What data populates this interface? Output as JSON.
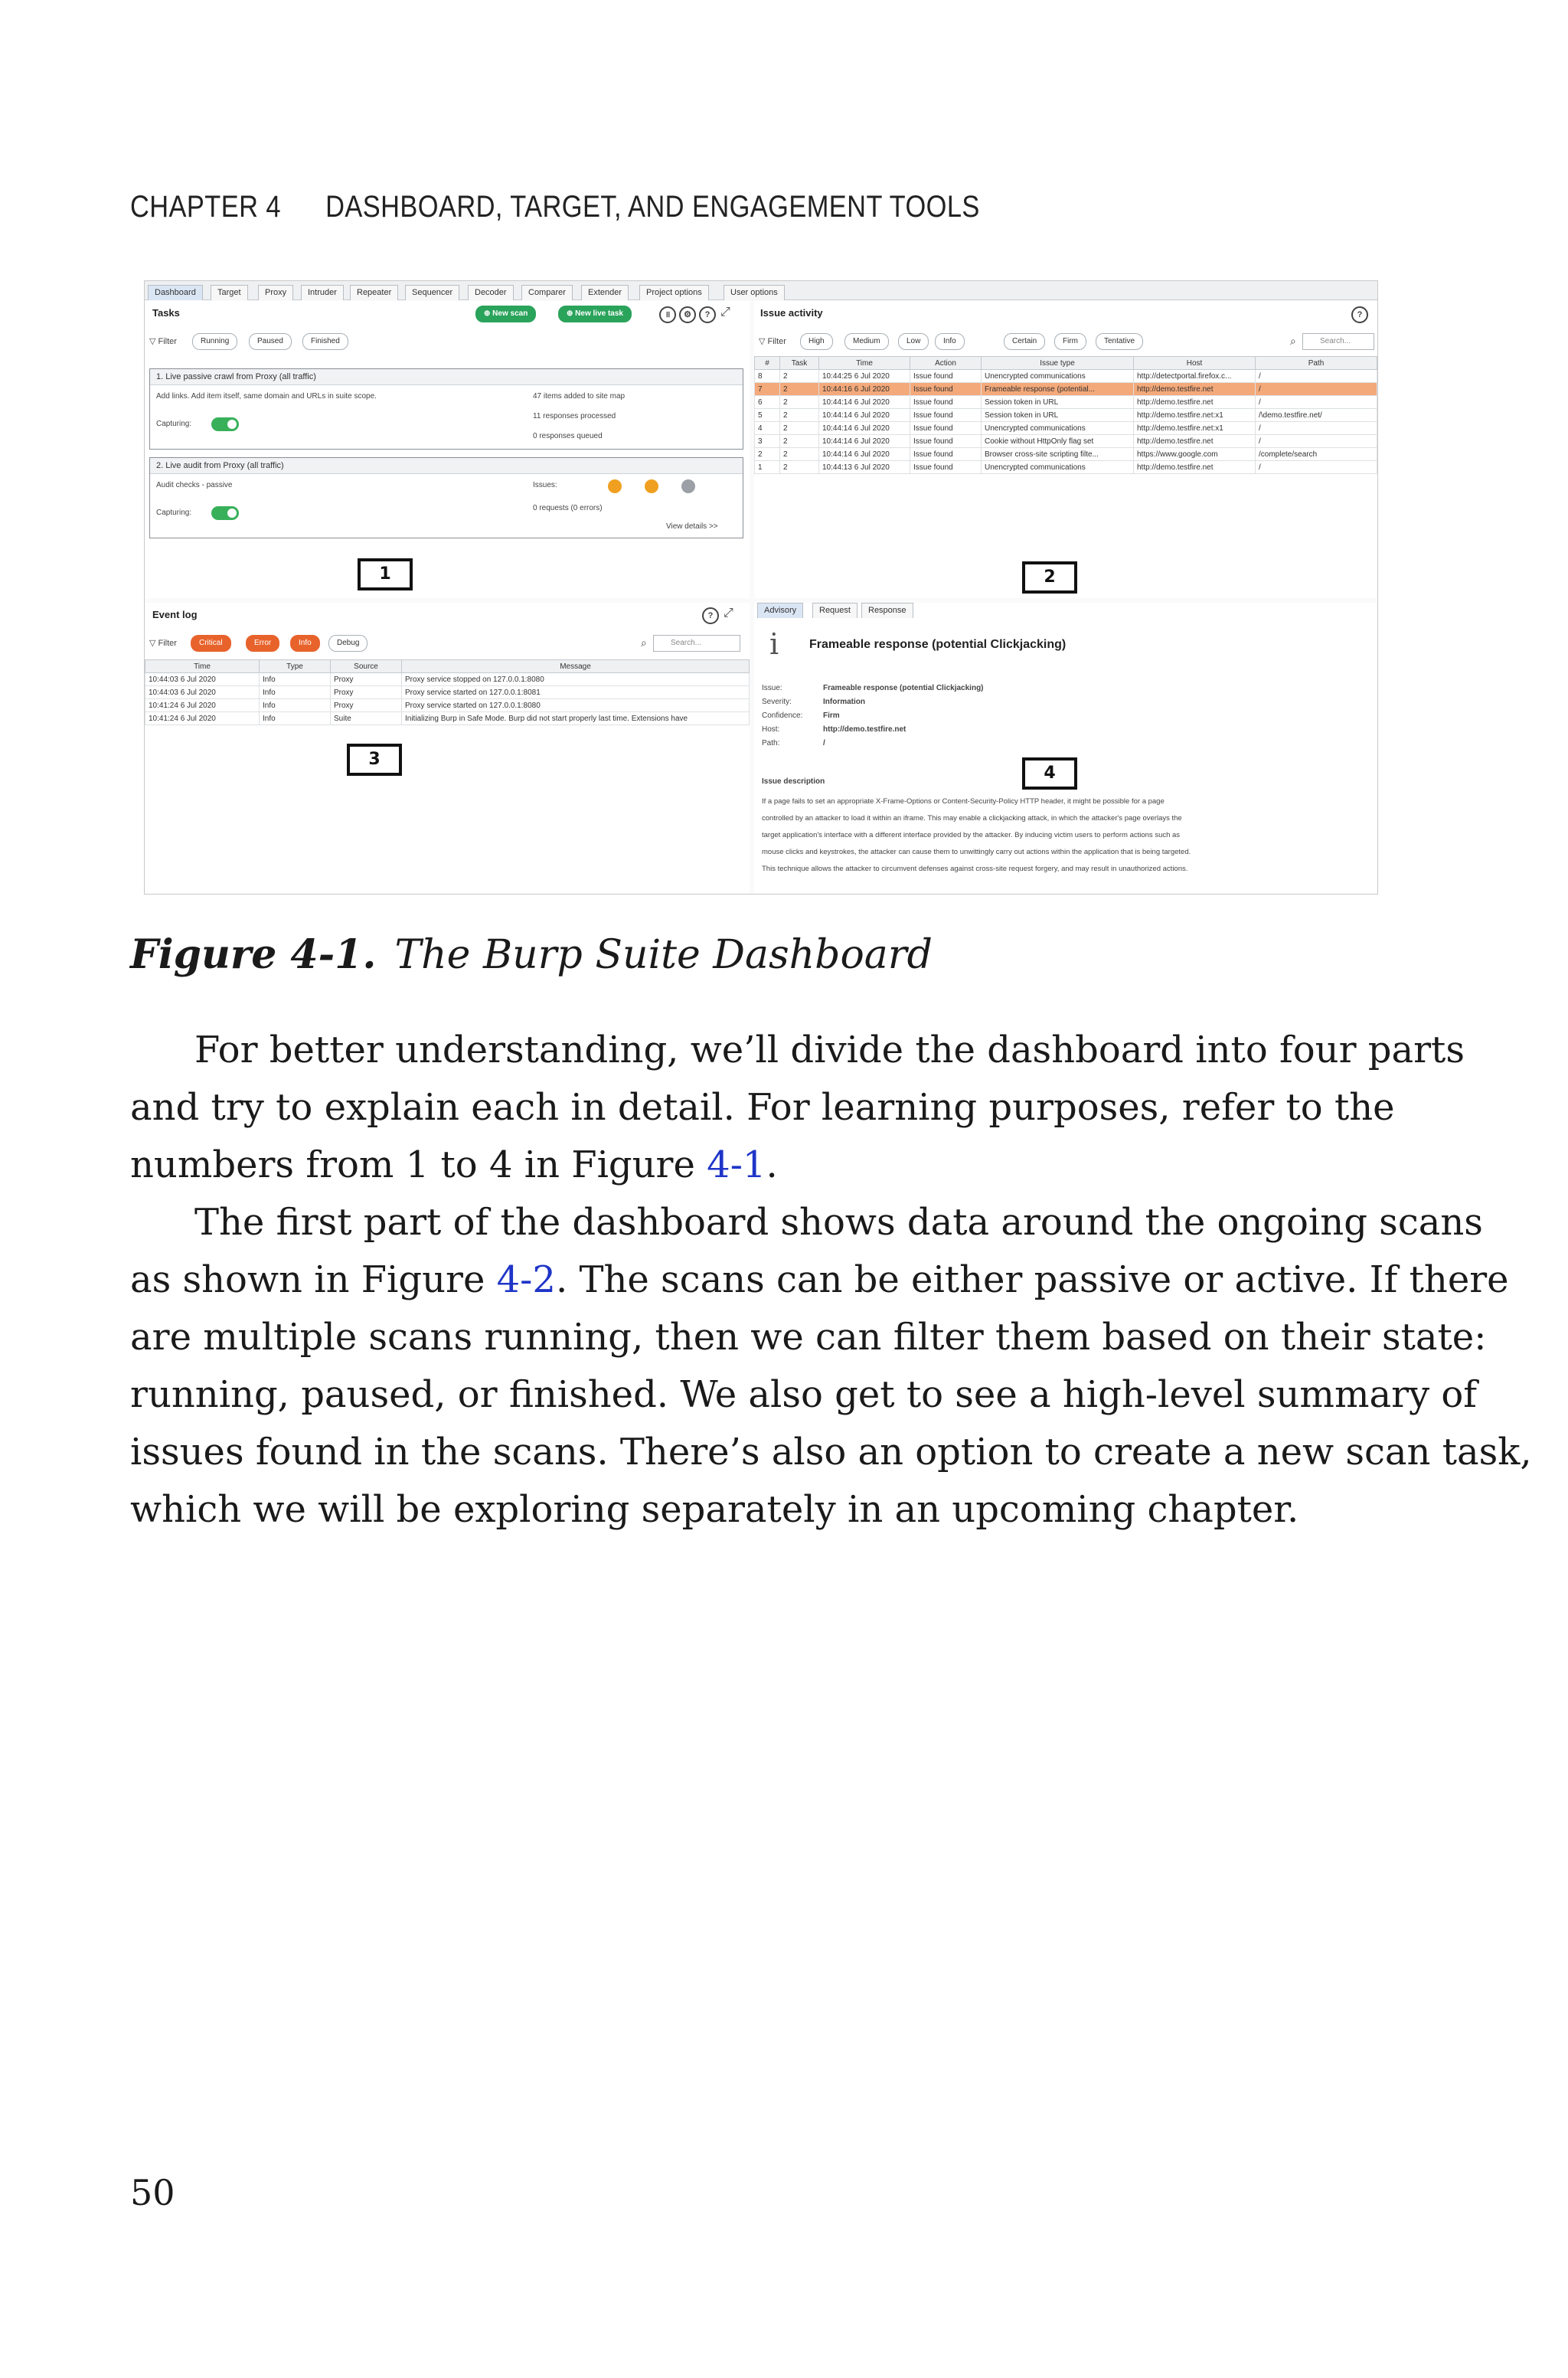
{
  "header": {
    "chapter": "CHAPTER 4",
    "title": "DASHBOARD, TARGET, AND ENGAGEMENT TOOLS"
  },
  "screenshot": {
    "tabs": [
      "Dashboard",
      "Target",
      "Proxy",
      "Intruder",
      "Repeater",
      "Sequencer",
      "Decoder",
      "Comparer",
      "Extender",
      "Project options",
      "User options"
    ],
    "tasks": {
      "title": "Tasks",
      "new_scan": "New scan",
      "new_live_task": "New live task",
      "filter_label": "Filter",
      "filters": [
        "Running",
        "Paused",
        "Finished"
      ],
      "task1": {
        "title": "1. Live passive crawl from Proxy (all traffic)",
        "desc": "Add links. Add item itself, same domain and URLs in suite scope.",
        "capturing": "Capturing:",
        "stats": [
          "47 items added to site map",
          "11 responses processed",
          "0 responses queued"
        ]
      },
      "task2": {
        "title": "2. Live audit from Proxy (all traffic)",
        "desc": "Audit checks - passive",
        "capturing": "Capturing:",
        "issues_label": "Issues:",
        "issue_counts": [
          "1",
          "4",
          "3"
        ],
        "requests": "0 requests (0 errors)",
        "view_details": "View details >>"
      }
    },
    "issue_activity": {
      "title": "Issue activity",
      "filter_label": "Filter",
      "filters": [
        "High",
        "Medium",
        "Low",
        "Info",
        "Certain",
        "Firm",
        "Tentative"
      ],
      "search_placeholder": "Search...",
      "columns": [
        "#",
        "Task",
        "Time",
        "Action",
        "Issue type",
        "Host",
        "Path"
      ],
      "rows": [
        [
          "8",
          "2",
          "10:44:25 6 Jul 2020",
          "Issue found",
          "Unencrypted communications",
          "http://detectportal.firefox.c...",
          "/"
        ],
        [
          "7",
          "2",
          "10:44:16 6 Jul 2020",
          "Issue found",
          "Frameable response (potential...",
          "http://demo.testfire.net",
          "/"
        ],
        [
          "6",
          "2",
          "10:44:14 6 Jul 2020",
          "Issue found",
          "Session token in URL",
          "http://demo.testfire.net",
          "/"
        ],
        [
          "5",
          "2",
          "10:44:14 6 Jul 2020",
          "Issue found",
          "Session token in URL",
          "http://demo.testfire.net:x1",
          "/\\demo.testfire.net/"
        ],
        [
          "4",
          "2",
          "10:44:14 6 Jul 2020",
          "Issue found",
          "Unencrypted communications",
          "http://demo.testfire.net:x1",
          "/"
        ],
        [
          "3",
          "2",
          "10:44:14 6 Jul 2020",
          "Issue found",
          "Cookie without HttpOnly flag set",
          "http://demo.testfire.net",
          "/"
        ],
        [
          "2",
          "2",
          "10:44:14 6 Jul 2020",
          "Issue found",
          "Browser cross-site scripting filte...",
          "https://www.google.com",
          "/complete/search"
        ],
        [
          "1",
          "2",
          "10:44:13 6 Jul 2020",
          "Issue found",
          "Unencrypted communications",
          "http://demo.testfire.net",
          "/"
        ]
      ]
    },
    "event_log": {
      "title": "Event log",
      "filter_label": "Filter",
      "filters": [
        "Critical",
        "Error",
        "Info",
        "Debug"
      ],
      "search_placeholder": "Search...",
      "columns": [
        "Time",
        "Type",
        "Source",
        "Message"
      ],
      "rows": [
        [
          "10:44:03 6 Jul 2020",
          "Info",
          "Proxy",
          "Proxy service stopped on 127.0.0.1:8080"
        ],
        [
          "10:44:03 6 Jul 2020",
          "Info",
          "Proxy",
          "Proxy service started on 127.0.0.1:8081"
        ],
        [
          "10:41:24 6 Jul 2020",
          "Info",
          "Proxy",
          "Proxy service started on 127.0.0.1:8080"
        ],
        [
          "10:41:24 6 Jul 2020",
          "Info",
          "Suite",
          "Initializing Burp in Safe Mode. Burp did not start properly last time. Extensions have"
        ]
      ]
    },
    "advisory": {
      "tabs": [
        "Advisory",
        "Request",
        "Response"
      ],
      "heading": "Frameable response (potential Clickjacking)",
      "fields": [
        [
          "Issue:",
          "Frameable response (potential Clickjacking)"
        ],
        [
          "Severity:",
          "Information"
        ],
        [
          "Confidence:",
          "Firm"
        ],
        [
          "Host:",
          "http://demo.testfire.net"
        ],
        [
          "Path:",
          "/"
        ]
      ],
      "desc_title": "Issue description",
      "desc_lines": [
        "If a page fails to set an appropriate X-Frame-Options or Content-Security-Policy HTTP header, it might be possible for a page",
        "controlled by an attacker to load it within an iframe. This may enable a clickjacking attack, in which the attacker's page overlays the",
        "target application's interface with a different interface provided by the attacker. By inducing victim users to perform actions such as",
        "mouse clicks and keystrokes, the attacker can cause them to unwittingly carry out actions within the application that is being targeted.",
        "This technique allows the attacker to circumvent defenses against cross-site request forgery, and may result in unauthorized actions."
      ]
    },
    "section_numbers": [
      "1",
      "2",
      "3",
      "4"
    ]
  },
  "caption": {
    "label": "Figure 4-1.",
    "text": "The Burp Suite Dashboard"
  },
  "paragraphs": {
    "p1": {
      "l1": "For better understanding, we’ll divide the dashboard into four parts",
      "l2": "and try to explain each in detail. For learning purposes, refer to the",
      "l3a": "numbers from 1 to 4 in Figure ",
      "l3link": "4-1",
      "l3b": "."
    },
    "p2": {
      "l1": "The first part of the dashboard shows data around the ongoing scans",
      "l2a": "as shown in Figure ",
      "l2link": "4-2",
      "l2b": ". The scans can be either passive or active. If there",
      "l3": "are multiple scans running, then we can filter them based on their state:",
      "l4": "running, paused, or finished. We also get to see a high-level summary of",
      "l5": "issues found in the scans. There’s also an option to create a new scan task,",
      "l6": "which we will be exploring separately in an upcoming chapter."
    }
  },
  "page_number": "50"
}
